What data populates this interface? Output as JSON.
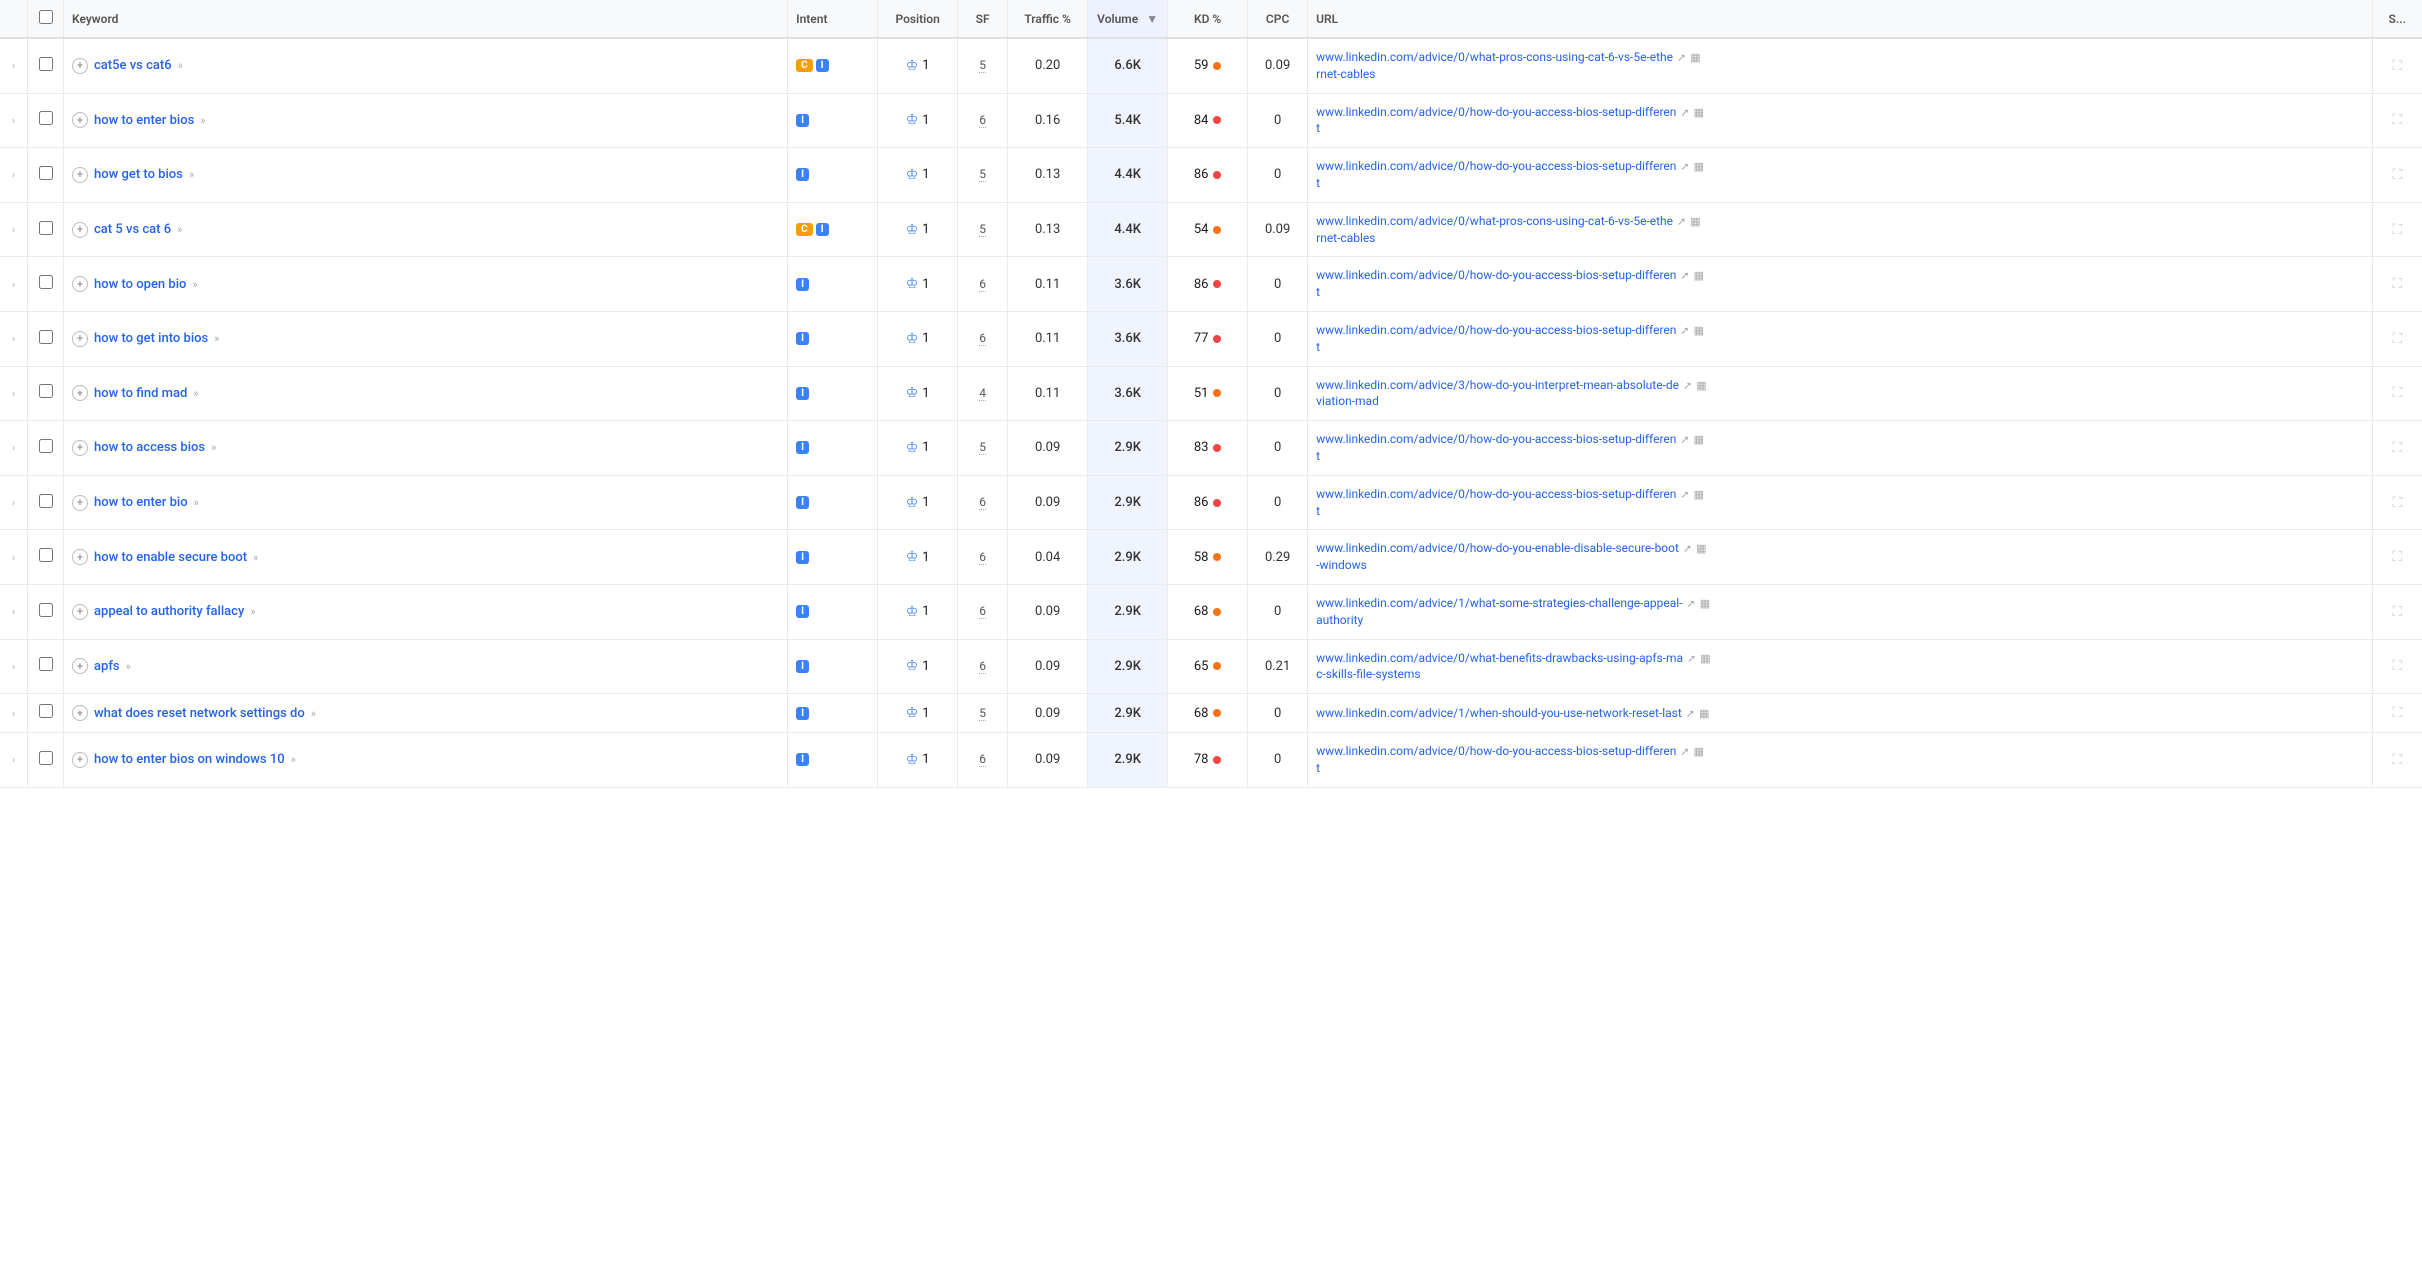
{
  "table": {
    "columns": [
      {
        "key": "expand",
        "label": ""
      },
      {
        "key": "checkbox",
        "label": ""
      },
      {
        "key": "keyword",
        "label": "Keyword"
      },
      {
        "key": "intent",
        "label": "Intent"
      },
      {
        "key": "position",
        "label": "Position"
      },
      {
        "key": "sf",
        "label": "SF"
      },
      {
        "key": "traffic",
        "label": "Traffic %"
      },
      {
        "key": "volume",
        "label": "Volume"
      },
      {
        "key": "kd",
        "label": "KD %"
      },
      {
        "key": "cpc",
        "label": "CPC"
      },
      {
        "key": "url",
        "label": "URL"
      },
      {
        "key": "s",
        "label": "S..."
      }
    ],
    "rows": [
      {
        "keyword": "cat5e vs cat6",
        "intent": [
          "C",
          "I"
        ],
        "position": 1,
        "sf": 5,
        "traffic": "0.20",
        "volume": "6.6K",
        "kd": 59,
        "kd_color": "orange",
        "cpc": "0.09",
        "url": "www.linkedin.com/advice/0/what-pros-cons-using-cat-6-vs-5e-ethernet-cables",
        "url_display": "www.linkedin.com/advice/0/what-pros-cons-using-cat-6-vs-5e-ethe\nrnet-cables"
      },
      {
        "keyword": "how to enter bios",
        "intent": [
          "I"
        ],
        "position": 1,
        "sf": 6,
        "traffic": "0.16",
        "volume": "5.4K",
        "kd": 84,
        "kd_color": "red",
        "cpc": "0",
        "url": "www.linkedin.com/advice/0/how-do-you-access-bios-setup-different",
        "url_display": "www.linkedin.com/advice/0/how-do-you-access-bios-setup-differen\nt"
      },
      {
        "keyword": "how get to bios",
        "intent": [
          "I"
        ],
        "position": 1,
        "sf": 5,
        "traffic": "0.13",
        "volume": "4.4K",
        "kd": 86,
        "kd_color": "red",
        "cpc": "0",
        "url": "www.linkedin.com/advice/0/how-do-you-access-bios-setup-different",
        "url_display": "www.linkedin.com/advice/0/how-do-you-access-bios-setup-differen\nt"
      },
      {
        "keyword": "cat 5 vs cat 6",
        "intent": [
          "C",
          "I"
        ],
        "position": 1,
        "sf": 5,
        "traffic": "0.13",
        "volume": "4.4K",
        "kd": 54,
        "kd_color": "orange",
        "cpc": "0.09",
        "url": "www.linkedin.com/advice/0/what-pros-cons-using-cat-6-vs-5e-ethernet-cables",
        "url_display": "www.linkedin.com/advice/0/what-pros-cons-using-cat-6-vs-5e-ethe\nrnet-cables"
      },
      {
        "keyword": "how to open bio",
        "intent": [
          "I"
        ],
        "position": 1,
        "sf": 6,
        "traffic": "0.11",
        "volume": "3.6K",
        "kd": 86,
        "kd_color": "red",
        "cpc": "0",
        "url": "www.linkedin.com/advice/0/how-do-you-access-bios-setup-different",
        "url_display": "www.linkedin.com/advice/0/how-do-you-access-bios-setup-differen\nt"
      },
      {
        "keyword": "how to get into bios",
        "intent": [
          "I"
        ],
        "position": 1,
        "sf": 6,
        "traffic": "0.11",
        "volume": "3.6K",
        "kd": 77,
        "kd_color": "red",
        "cpc": "0",
        "url": "www.linkedin.com/advice/0/how-do-you-access-bios-setup-different",
        "url_display": "www.linkedin.com/advice/0/how-do-you-access-bios-setup-differen\nt"
      },
      {
        "keyword": "how to find mad",
        "intent": [
          "I"
        ],
        "position": 1,
        "sf": 4,
        "traffic": "0.11",
        "volume": "3.6K",
        "kd": 51,
        "kd_color": "orange",
        "cpc": "0",
        "url": "www.linkedin.com/advice/3/how-do-you-interpret-mean-absolute-deviation-mad",
        "url_display": "www.linkedin.com/advice/3/how-do-you-interpret-mean-absolute-de\nviation-mad"
      },
      {
        "keyword": "how to access bios",
        "intent": [
          "I"
        ],
        "position": 1,
        "sf": 5,
        "traffic": "0.09",
        "volume": "2.9K",
        "kd": 83,
        "kd_color": "red",
        "cpc": "0",
        "url": "www.linkedin.com/advice/0/how-do-you-access-bios-setup-different",
        "url_display": "www.linkedin.com/advice/0/how-do-you-access-bios-setup-differen\nt"
      },
      {
        "keyword": "how to enter bio",
        "intent": [
          "I"
        ],
        "position": 1,
        "sf": 6,
        "traffic": "0.09",
        "volume": "2.9K",
        "kd": 86,
        "kd_color": "red",
        "cpc": "0",
        "url": "www.linkedin.com/advice/0/how-do-you-access-bios-setup-different",
        "url_display": "www.linkedin.com/advice/0/how-do-you-access-bios-setup-differen\nt"
      },
      {
        "keyword": "how to enable secure boot",
        "intent": [
          "I"
        ],
        "position": 1,
        "sf": 6,
        "traffic": "0.04",
        "volume": "2.9K",
        "kd": 58,
        "kd_color": "orange",
        "cpc": "0.29",
        "url": "www.linkedin.com/advice/0/how-do-you-enable-disable-secure-boot-windows",
        "url_display": "www.linkedin.com/advice/0/how-do-you-enable-disable-secure-boot\n-windows"
      },
      {
        "keyword": "appeal to authority fallacy",
        "intent": [
          "I"
        ],
        "position": 1,
        "sf": 6,
        "traffic": "0.09",
        "volume": "2.9K",
        "kd": 68,
        "kd_color": "orange",
        "cpc": "0",
        "url": "www.linkedin.com/advice/1/what-some-strategies-challenge-appeal-authority",
        "url_display": "www.linkedin.com/advice/1/what-some-strategies-challenge-appeal-\nauthority"
      },
      {
        "keyword": "apfs",
        "intent": [
          "I"
        ],
        "position": 1,
        "sf": 6,
        "traffic": "0.09",
        "volume": "2.9K",
        "kd": 65,
        "kd_color": "orange",
        "cpc": "0.21",
        "url": "www.linkedin.com/advice/0/what-benefits-drawbacks-using-apfs-mac-skills-file-systems",
        "url_display": "www.linkedin.com/advice/0/what-benefits-drawbacks-using-apfs-ma\nc-skills-file-systems"
      },
      {
        "keyword": "what does reset network settings do",
        "intent": [
          "I"
        ],
        "position": 1,
        "sf": 5,
        "traffic": "0.09",
        "volume": "2.9K",
        "kd": 68,
        "kd_color": "orange",
        "cpc": "0",
        "url": "www.linkedin.com/advice/1/when-should-you-use-network-reset-last",
        "url_display": "www.linkedin.com/advice/1/when-should-you-use-network-reset-last"
      },
      {
        "keyword": "how to enter bios on windows 10",
        "intent": [
          "I"
        ],
        "position": 1,
        "sf": 6,
        "traffic": "0.09",
        "volume": "2.9K",
        "kd": 78,
        "kd_color": "red",
        "cpc": "0",
        "url": "www.linkedin.com/advice/0/how-do-you-access-bios-setup-different",
        "url_display": "www.linkedin.com/advice/0/how-do-you-access-bios-setup-differen\nt"
      }
    ]
  }
}
